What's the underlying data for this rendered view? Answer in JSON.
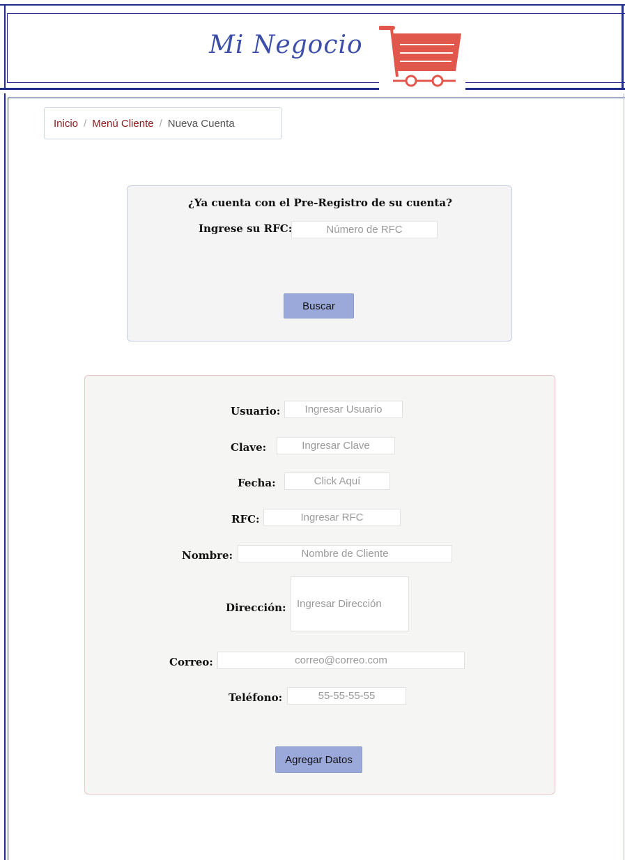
{
  "header": {
    "logo_text": "Mi Negocio",
    "cart_icon": "shopping-cart-icon",
    "brand_color": "#e2574c",
    "frame_color": "#1f2f86"
  },
  "breadcrumb": {
    "items": [
      "Inicio",
      "Menú Cliente",
      "Nueva Cuenta"
    ],
    "separator": "/"
  },
  "search_panel": {
    "question": "¿Ya cuenta con el Pre-Registro de su cuenta?",
    "rfc_label": "Ingrese su RFC:",
    "rfc_placeholder": "Número de RFC",
    "button": "Buscar"
  },
  "form": {
    "usuario_label": "Usuario:",
    "usuario_placeholder": "Ingresar Usuario",
    "clave_label": "Clave:",
    "clave_placeholder": "Ingresar Clave",
    "fecha_label": "Fecha:",
    "fecha_placeholder": "Click Aquí",
    "rfc_label": "RFC:",
    "rfc_placeholder": "Ingresar RFC",
    "nombre_label": "Nombre:",
    "nombre_placeholder": "Nombre de Cliente",
    "direccion_label": "Dirección:",
    "direccion_placeholder": "Ingresar Dirección",
    "correo_label": "Correo:",
    "correo_placeholder": "correo@correo.com",
    "telefono_label": "Teléfono:",
    "telefono_placeholder": "55-55-55-55",
    "submit": "Agregar Datos"
  }
}
